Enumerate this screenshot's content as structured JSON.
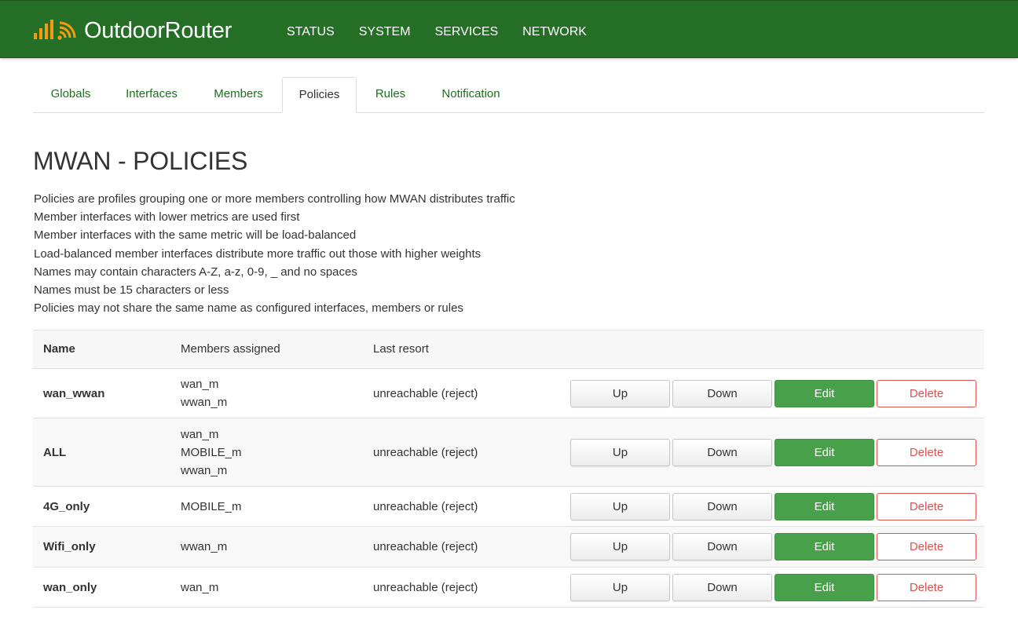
{
  "header": {
    "brand": "OutdoorRouter",
    "nav": [
      "STATUS",
      "SYSTEM",
      "SERVICES",
      "NETWORK"
    ]
  },
  "tabs": [
    {
      "label": "Globals",
      "active": false
    },
    {
      "label": "Interfaces",
      "active": false
    },
    {
      "label": "Members",
      "active": false
    },
    {
      "label": "Policies",
      "active": true
    },
    {
      "label": "Rules",
      "active": false
    },
    {
      "label": "Notification",
      "active": false
    }
  ],
  "page": {
    "title": "MWAN - POLICIES",
    "description": [
      "Policies are profiles grouping one or more members controlling how MWAN distributes traffic",
      "Member interfaces with lower metrics are used first",
      "Member interfaces with the same metric will be load-balanced",
      "Load-balanced member interfaces distribute more traffic out those with higher weights",
      "Names may contain characters A-Z, a-z, 0-9, _ and no spaces",
      "Names must be 15 characters or less",
      "Policies may not share the same name as configured interfaces, members or rules"
    ]
  },
  "table": {
    "headers": {
      "name": "Name",
      "members": "Members assigned",
      "last_resort": "Last resort"
    },
    "buttons": {
      "up": "Up",
      "down": "Down",
      "edit": "Edit",
      "delete": "Delete"
    },
    "rows": [
      {
        "name": "wan_wwan",
        "members": [
          "wan_m",
          "wwan_m"
        ],
        "last_resort": "unreachable (reject)"
      },
      {
        "name": "ALL",
        "members": [
          "wan_m",
          "MOBILE_m",
          "wwan_m"
        ],
        "last_resort": "unreachable (reject)"
      },
      {
        "name": "4G_only",
        "members": [
          "MOBILE_m"
        ],
        "last_resort": "unreachable (reject)"
      },
      {
        "name": "Wifi_only",
        "members": [
          "wwan_m"
        ],
        "last_resort": "unreachable (reject)"
      },
      {
        "name": "wan_only",
        "members": [
          "wan_m"
        ],
        "last_resort": "unreachable (reject)"
      }
    ]
  },
  "colors": {
    "header_bg": "#256e26",
    "link": "#1f6e1f",
    "edit_button": "#48a14a",
    "delete_button": "#d9534f",
    "signal_icon": "#f39c12"
  },
  "icons": {
    "brand": "signal-wifi-icon"
  }
}
